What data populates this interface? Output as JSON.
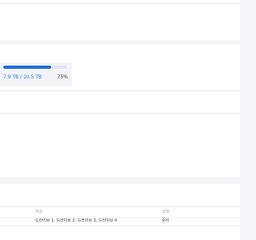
{
  "storage": {
    "used_text": "7.9 TB / 10.5 TB",
    "percent_text": "75%",
    "percent_value": 75,
    "accent_color": "#1f6ed4"
  },
  "table": {
    "headers": {
      "target": "대상",
      "status": "상태"
    },
    "rows": [
      {
        "target": "드라이브 1, 드라이브 2, 드라이브 3, 드라이브 4",
        "status": "준비"
      }
    ]
  }
}
